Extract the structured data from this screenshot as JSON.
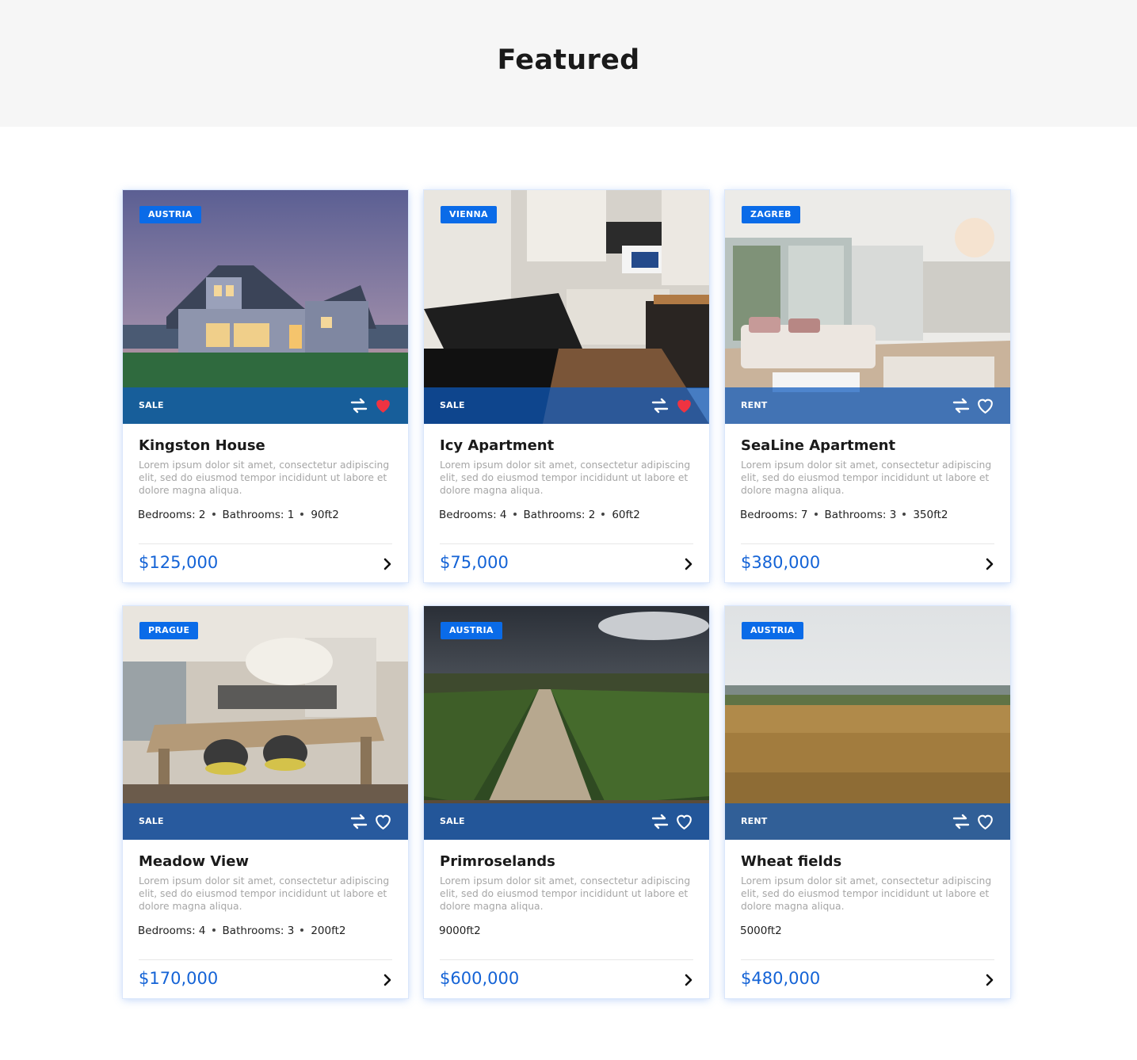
{
  "section": {
    "title": "Featured"
  },
  "colors": {
    "accent": "#0a6be8",
    "price": "#1463d6",
    "favorite": "#ef3341",
    "hero_bg": "#f6f6f6"
  },
  "listings": [
    {
      "location": "AUSTRIA",
      "deal": "SALE",
      "favorited": true,
      "photo_icon": "house-photo",
      "title": "Kingston House",
      "description": "Lorem ipsum dolor sit amet, consectetur adipiscing elit, sed do eiusmod tempor incididunt ut labore et dolore magna aliqua.",
      "specs": [
        "Bedrooms: 2",
        "Bathrooms: 1",
        "90ft2"
      ],
      "price": "$125,000"
    },
    {
      "location": "VIENNA",
      "deal": "SALE",
      "favorited": true,
      "photo_icon": "kitchen-photo",
      "title": "Icy Apartment",
      "description": "Lorem ipsum dolor sit amet, consectetur adipiscing elit, sed do eiusmod tempor incididunt ut labore et dolore magna aliqua.",
      "specs": [
        "Bedrooms: 4",
        "Bathrooms: 2",
        "60ft2"
      ],
      "price": "$75,000"
    },
    {
      "location": "ZAGREB",
      "deal": "RENT",
      "favorited": false,
      "photo_icon": "living-room-photo",
      "title": "SeaLine Apartment",
      "description": "Lorem ipsum dolor sit amet, consectetur adipiscing elit, sed do eiusmod tempor incididunt ut labore et dolore magna aliqua.",
      "specs": [
        "Bedrooms: 7",
        "Bathrooms: 3",
        "350ft2"
      ],
      "price": "$380,000"
    },
    {
      "location": "PRAGUE",
      "deal": "SALE",
      "favorited": false,
      "photo_icon": "dining-room-photo",
      "title": "Meadow View",
      "description": "Lorem ipsum dolor sit amet, consectetur adipiscing elit, sed do eiusmod tempor incididunt ut labore et dolore magna aliqua.",
      "specs": [
        "Bedrooms: 4",
        "Bathrooms: 3",
        "200ft2"
      ],
      "price": "$170,000"
    },
    {
      "location": "AUSTRIA",
      "deal": "SALE",
      "favorited": false,
      "photo_icon": "vineyard-road-photo",
      "title": "Primroselands",
      "description": "Lorem ipsum dolor sit amet, consectetur adipiscing elit, sed do eiusmod tempor incididunt ut labore et dolore magna aliqua.",
      "specs": [
        "9000ft2"
      ],
      "price": "$600,000"
    },
    {
      "location": "AUSTRIA",
      "deal": "RENT",
      "favorited": false,
      "photo_icon": "wheat-field-photo",
      "title": "Wheat fields",
      "description": "Lorem ipsum dolor sit amet, consectetur adipiscing elit, sed do eiusmod tempor incididunt ut labore et dolore magna aliqua.",
      "specs": [
        "5000ft2"
      ],
      "price": "$480,000"
    }
  ]
}
